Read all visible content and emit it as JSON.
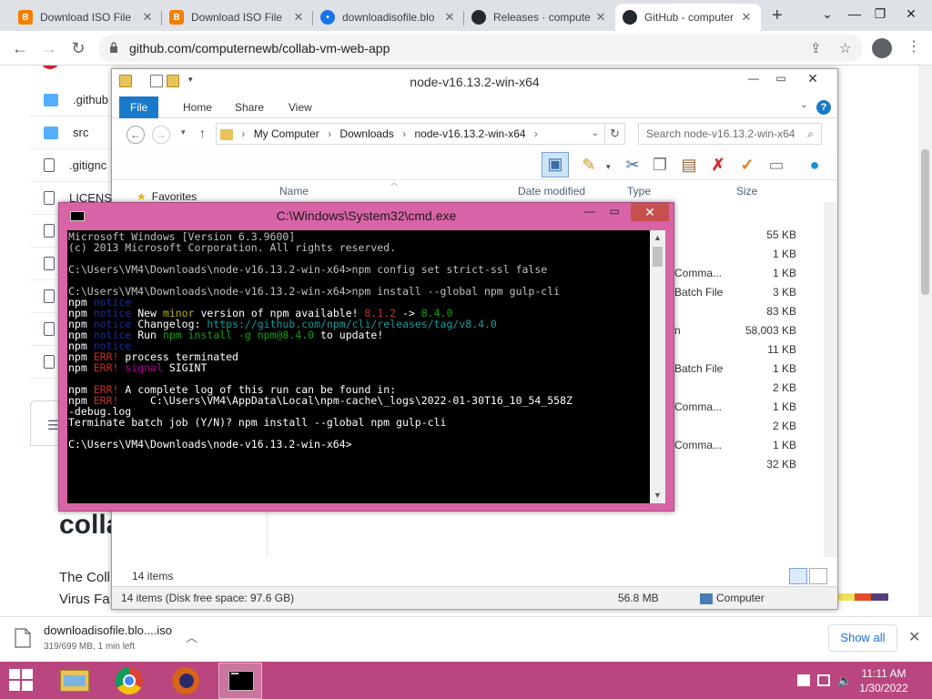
{
  "browser": {
    "tabs": [
      {
        "title": "Download ISO File",
        "icon": "blogger-icon"
      },
      {
        "title": "Download ISO File",
        "icon": "blogger-icon"
      },
      {
        "title": "downloadisofile.blo",
        "icon": "blogger-icon"
      },
      {
        "title": "Releases · compute",
        "icon": "github-icon"
      },
      {
        "title": "GitHub - computer",
        "icon": "github-icon"
      }
    ],
    "url": "github.com/computernewb/collab-vm-web-app"
  },
  "github": {
    "files": [
      {
        "name": ".github",
        "type": "folder"
      },
      {
        "name": "src",
        "type": "folder"
      },
      {
        "name": ".gitignc",
        "type": "file"
      },
      {
        "name": "LICENS",
        "type": "file"
      },
      {
        "name": "",
        "type": "file"
      },
      {
        "name": "",
        "type": "file"
      },
      {
        "name": "",
        "type": "file"
      },
      {
        "name": "",
        "type": "file"
      },
      {
        "name": "",
        "type": "file"
      }
    ],
    "readme_title": "colla",
    "readme_line1": "The Coll",
    "readme_line2": "Virus Fa"
  },
  "explorer": {
    "title": "node-v16.13.2-win-x64",
    "ribbon_tabs": [
      "File",
      "Home",
      "Share",
      "View"
    ],
    "breadcrumb": [
      "My Computer",
      "Downloads",
      "node-v16.13.2-win-x64"
    ],
    "search_placeholder": "Search node-v16.13.2-win-x64",
    "columns": {
      "name": "Name",
      "date": "Date modified",
      "type": "Type",
      "size": "Size"
    },
    "favorites": "Favorites",
    "rows": [
      {
        "type": "",
        "size": "55 KB"
      },
      {
        "type": "",
        "size": "1 KB"
      },
      {
        "type": "Comma...",
        "size": "1 KB"
      },
      {
        "type": "Batch File",
        "size": "3 KB"
      },
      {
        "type": "",
        "size": "83 KB"
      },
      {
        "type": "n",
        "size": "58,003 KB"
      },
      {
        "type": "",
        "size": "11 KB"
      },
      {
        "type": "Batch File",
        "size": "1 KB"
      },
      {
        "type": "",
        "size": "2 KB"
      },
      {
        "type": "Comma...",
        "size": "1 KB"
      },
      {
        "type": "",
        "size": "2 KB"
      },
      {
        "type": "Comma...",
        "size": "1 KB"
      },
      {
        "type": "",
        "size": "32 KB"
      }
    ],
    "item_count": "14 items",
    "status_items": "14 items (Disk free space: 97.6 GB)",
    "status_size": "56.8 MB",
    "status_location": "Computer"
  },
  "cmd": {
    "title": "C:\\Windows\\System32\\cmd.exe",
    "lines": {
      "l1": "Microsoft Windows [Version 6.3.9600]",
      "l2": "(c) 2013 Microsoft Corporation. All rights reserved.",
      "l3": "C:\\Users\\VM4\\Downloads\\node-v16.13.2-win-x64>npm config set strict-ssl false",
      "l4": "C:\\Users\\VM4\\Downloads\\node-v16.13.2-win-x64>npm install --global npm gulp-cli",
      "npm": "npm",
      "notice": "notice",
      "err": "ERR!",
      "minor_a": "New ",
      "minor_b": "minor",
      "minor_c": " version of npm available! ",
      "minor_old": "8.1.2",
      "minor_arrow": " -> ",
      "minor_new": "8.4.0",
      "changelog": "Changelog: ",
      "changelog_url": "https://github.com/npm/cli/releases/tag/v8.4.0",
      "run_a": "Run ",
      "run_cmd": "npm install -g npm@8.4.0",
      "run_b": " to update!",
      "proc": "process terminated",
      "signal": "signal",
      "sigint": " SIGINT",
      "log1": "A complete log of this run can be found in:",
      "log2": "     C:\\Users\\VM4\\AppData\\Local\\npm-cache\\_logs\\2022-01-30T16_10_54_558Z",
      "log3": "-debug.log",
      "term": "Terminate batch job (Y/N)? npm install --global npm gulp-cli",
      "prompt": "C:\\Users\\VM4\\Downloads\\node-v16.13.2-win-x64>"
    }
  },
  "downloads": {
    "filename": "downloadisofile.blo....iso",
    "status": "319/699 MB, 1 min left",
    "show_all": "Show all"
  },
  "taskbar": {
    "apps": [
      "file-explorer-icon",
      "chrome-icon",
      "firefox-icon",
      "cmd-icon"
    ],
    "time": "11:11 AM",
    "date": "1/30/2022"
  },
  "colors": {
    "taskbar": "#b9467e",
    "cmd_frame": "#d864a6",
    "explorer_accent": "#1979ca",
    "chrome_tabstrip": "#dee1e6"
  }
}
